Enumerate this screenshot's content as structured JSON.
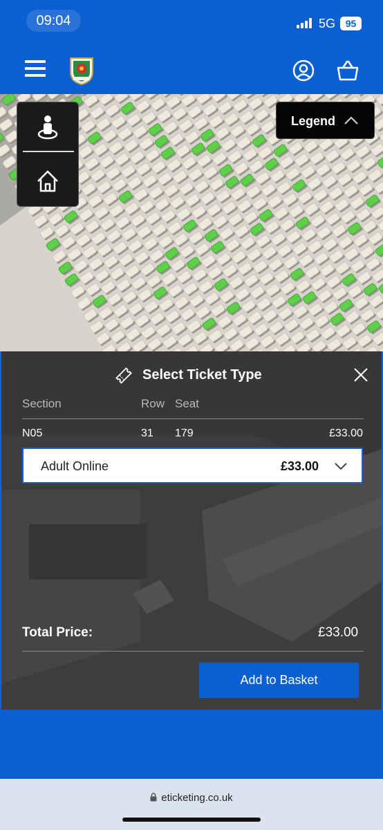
{
  "status_bar": {
    "time": "09:04",
    "network": "5G",
    "battery": "95"
  },
  "header": {
    "menu_icon": "hamburger-menu-icon",
    "crest": "club-crest-logo",
    "account_icon": "account-icon",
    "basket_icon": "basket-icon"
  },
  "map": {
    "view_icon": "person-view-icon",
    "home_icon": "home-icon",
    "legend_label": "Legend",
    "colors": {
      "seat": "#efe8dc",
      "available_seat": "#5fcf4a",
      "floor": "#d8d4cd"
    }
  },
  "panel": {
    "title": "Select Ticket Type",
    "ticket_icon": "ticket-icon",
    "close_icon": "close-icon",
    "columns": {
      "section": "Section",
      "row": "Row",
      "seat": "Seat"
    },
    "selection": {
      "section": "N05",
      "row": "31",
      "seat": "179",
      "price": "£33.00"
    },
    "ticket_type": {
      "label": "Adult Online",
      "price": "£33.00"
    },
    "total_label": "Total Price:",
    "total_value": "£33.00",
    "add_button": "Add to Basket"
  },
  "browser": {
    "url": "eticketing.co.uk"
  },
  "colors": {
    "brand_blue": "#0a5fd2",
    "panel_bg": "#3d3d3d"
  }
}
